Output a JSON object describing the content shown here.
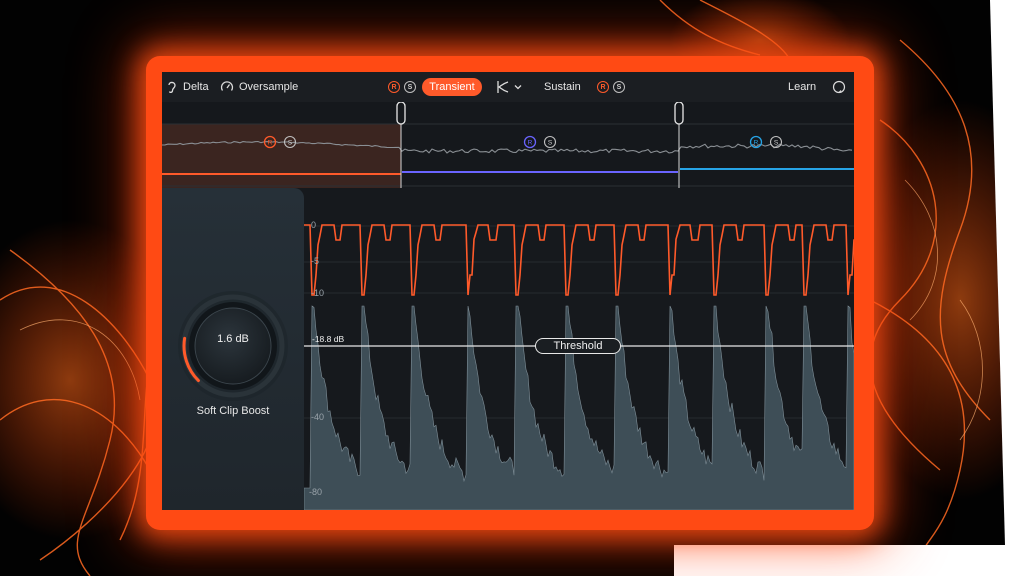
{
  "toolbar": {
    "delta_label": "Delta",
    "oversample_label": "Oversample",
    "transient_label": "Transient",
    "sustain_label": "Sustain",
    "learn_label": "Learn",
    "r_glyph": "R",
    "s_glyph": "S",
    "icons": [
      "ear-icon",
      "speedometer-icon",
      "curve-select-icon",
      "chevron-down-icon",
      "help-icon"
    ]
  },
  "bands": [
    {
      "color": "#ff5a2a",
      "r": "R",
      "s": "S"
    },
    {
      "color": "#6a64ff",
      "r": "R",
      "s": "S"
    },
    {
      "color": "#27a4e6",
      "r": "R",
      "s": "S"
    }
  ],
  "knob": {
    "value": "1.6 dB",
    "label": "Soft Clip Boost",
    "level": 0.2
  },
  "graph": {
    "threshold_label": "Threshold",
    "threshold_db": "-18.8 dB",
    "y_labels": [
      "0",
      "-5",
      "-10",
      "-40",
      "-80"
    ]
  },
  "colors": {
    "accent": "#ff5a2a",
    "panel": "#16191d",
    "waveform": "#3e4e57"
  }
}
